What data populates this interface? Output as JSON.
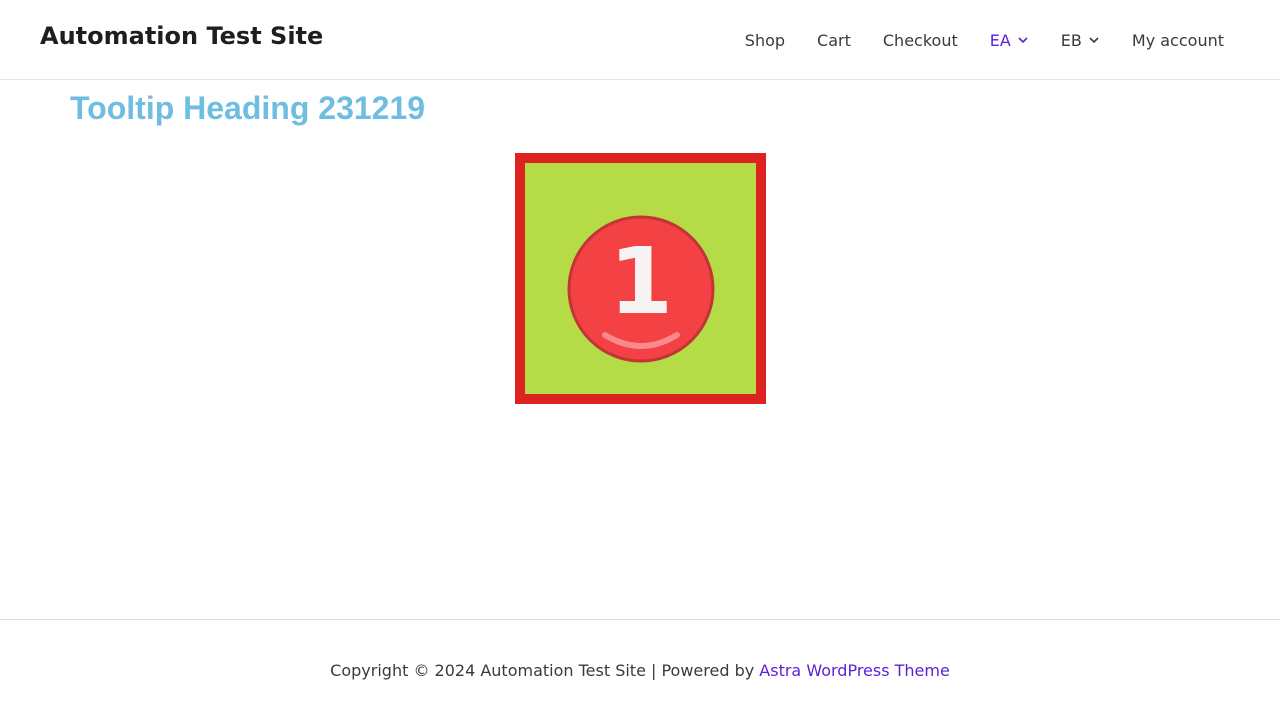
{
  "header": {
    "site_title": "Automation Test Site",
    "nav": {
      "shop": "Shop",
      "cart": "Cart",
      "checkout": "Checkout",
      "ea": "EA",
      "eb": "EB",
      "my_account": "My account"
    },
    "active_color": "#5b21d6"
  },
  "main": {
    "heading": "Tooltip Heading 231219",
    "heading_color": "#6fbde0",
    "image": {
      "badge_number": "1",
      "border_color": "#dc231f",
      "background_color": "#b5db46",
      "badge_color": "#f44144"
    }
  },
  "footer": {
    "copyright": "Copyright © 2024 Automation Test Site | Powered by ",
    "theme_link": "Astra WordPress Theme"
  }
}
